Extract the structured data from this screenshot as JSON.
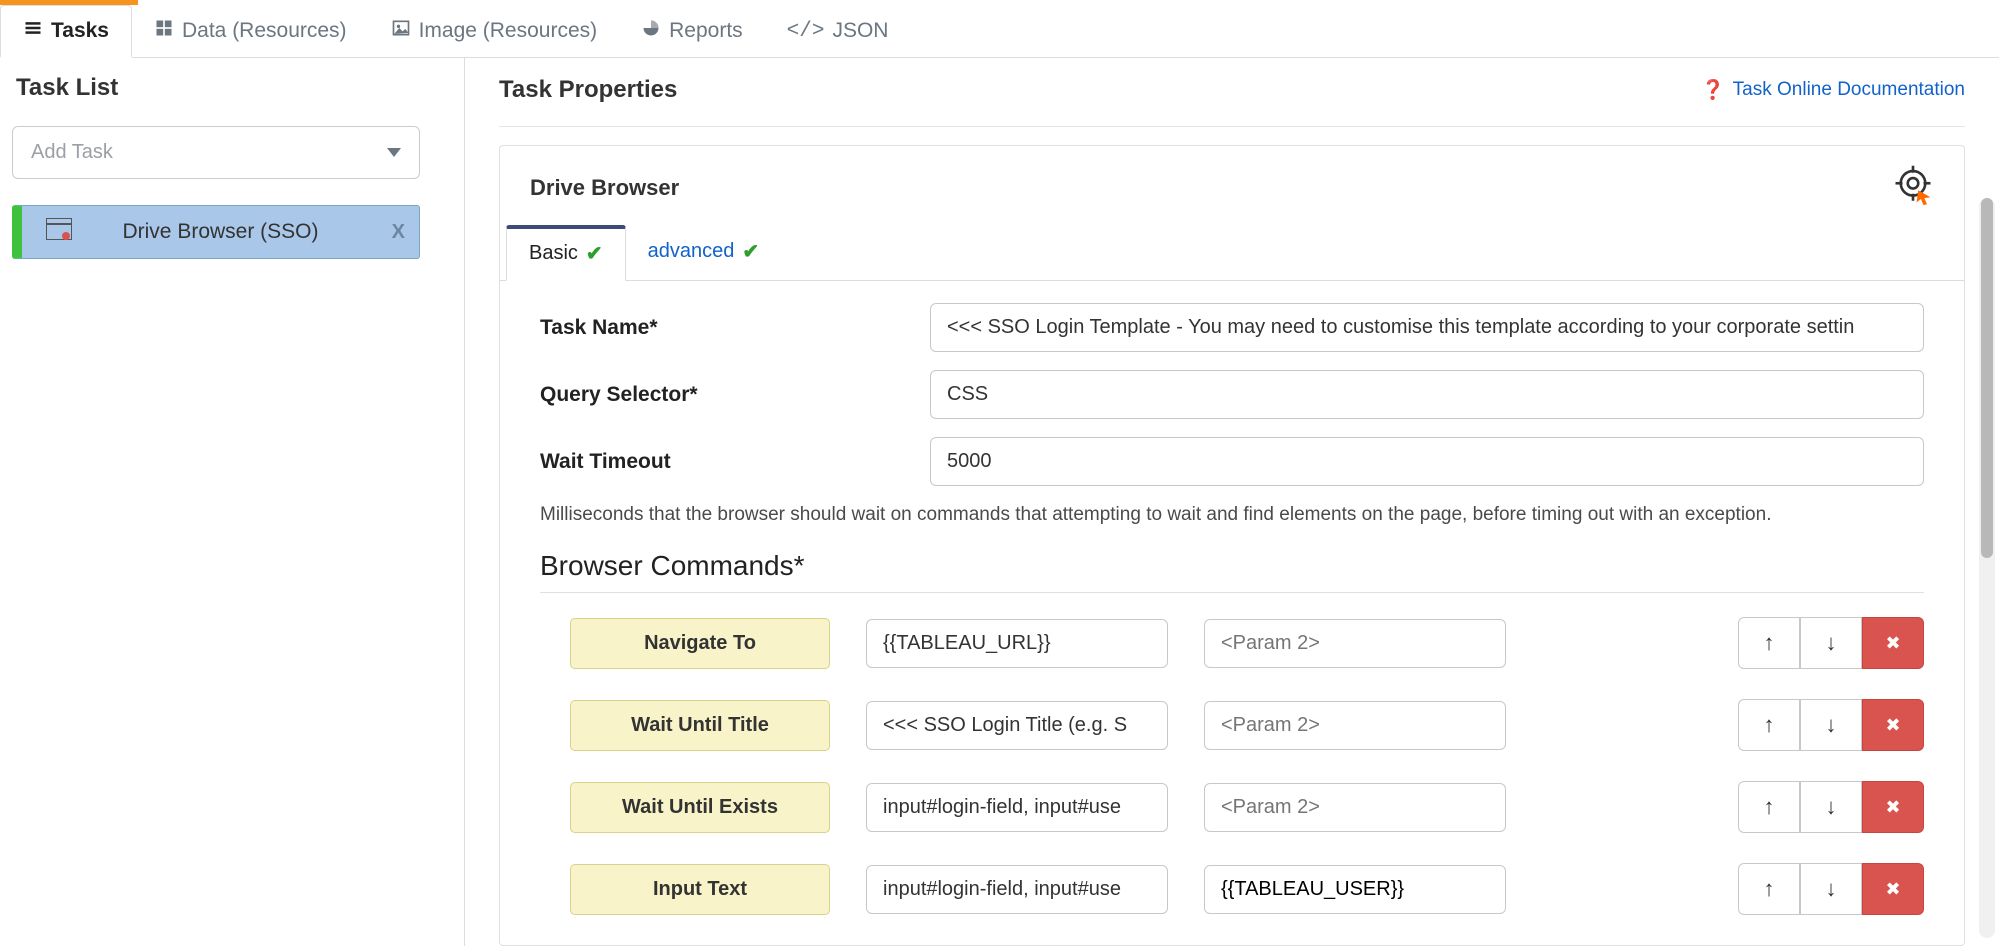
{
  "tabs": {
    "main": [
      {
        "label": "Tasks",
        "icon": "list-icon",
        "active": true
      },
      {
        "label": "Data (Resources)",
        "icon": "grid-icon",
        "active": false
      },
      {
        "label": "Image (Resources)",
        "icon": "image-icon",
        "active": false
      },
      {
        "label": "Reports",
        "icon": "pie-icon",
        "active": false
      },
      {
        "label": "JSON",
        "icon": "code-icon",
        "active": false
      }
    ]
  },
  "sidebar": {
    "heading": "Task List",
    "add_placeholder": "Add Task",
    "items": [
      {
        "label": "Drive Browser (SSO)"
      }
    ]
  },
  "content": {
    "heading": "Task Properties",
    "doc_link_label": "Task Online Documentation",
    "panel_title": "Drive Browser",
    "sub_tabs": [
      {
        "label": "Basic",
        "active": true
      },
      {
        "label": "advanced",
        "active": false
      }
    ],
    "fields": {
      "task_name_label": "Task Name*",
      "task_name_value": "<<< SSO Login Template - You may need to customise this template according to your corporate settin",
      "query_selector_label": "Query Selector*",
      "query_selector_value": "CSS",
      "wait_timeout_label": "Wait Timeout",
      "wait_timeout_value": "5000",
      "wait_help": "Milliseconds that the browser should wait on commands that attempting to wait and find elements on the page, before timing out with an exception."
    },
    "commands_heading": "Browser Commands*",
    "commands": [
      {
        "action": "Navigate To",
        "p1": "{{TABLEAU_URL}}",
        "p2": "",
        "p2_placeholder": "<Param 2>"
      },
      {
        "action": "Wait Until Title",
        "p1": "<<< SSO Login Title (e.g. S",
        "p2": "",
        "p2_placeholder": "<Param 2>"
      },
      {
        "action": "Wait Until Exists",
        "p1": "input#login-field, input#use",
        "p2": "",
        "p2_placeholder": "<Param 2>"
      },
      {
        "action": "Input Text",
        "p1": "input#login-field, input#use",
        "p2": "{{TABLEAU_USER}}",
        "p2_placeholder": "<Param 2>"
      }
    ]
  }
}
